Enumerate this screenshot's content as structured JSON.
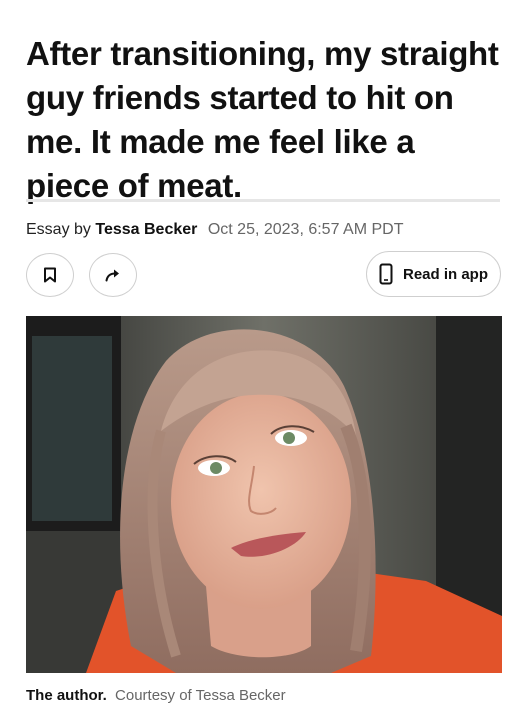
{
  "article": {
    "headline": "After transitioning, my straight guy friends started to hit on me. It made me feel like a piece of meat.",
    "byline_prefix": "Essay by",
    "author": "Tessa Becker",
    "date": "Oct 25, 2023, 6:57 AM PDT"
  },
  "actions": {
    "bookmark_icon": "bookmark-icon",
    "share_icon": "share-arrow-icon",
    "read_in_app_icon": "phone-icon",
    "read_in_app_label": "Read in app"
  },
  "photo": {
    "caption_label": "The author.",
    "caption_credit": "Courtesy of Tessa Becker"
  },
  "colors": {
    "text": "#111111",
    "muted": "#666666",
    "border": "#cfcfcf",
    "divider": "#e6e6e6"
  }
}
